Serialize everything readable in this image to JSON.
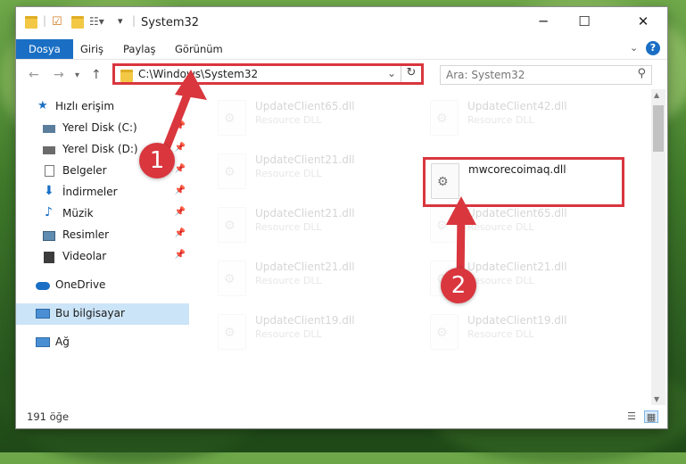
{
  "window": {
    "title": "System32"
  },
  "ribbon": {
    "tabs": [
      {
        "label": "Dosya",
        "active": true
      },
      {
        "label": "Giriş"
      },
      {
        "label": "Paylaş"
      },
      {
        "label": "Görünüm"
      }
    ]
  },
  "address": {
    "path": "C:\\Windows\\System32"
  },
  "search": {
    "placeholder": "Ara: System32"
  },
  "nav": {
    "items": [
      {
        "label": "Hızlı erişim",
        "icon": "star-icon"
      },
      {
        "label": "Yerel Disk (C:)",
        "icon": "drive-icon",
        "pinned": true
      },
      {
        "label": "Yerel Disk (D:)",
        "icon": "drive-icon",
        "pinned": true
      },
      {
        "label": "Belgeler",
        "icon": "documents-icon",
        "pinned": true
      },
      {
        "label": "İndirmeler",
        "icon": "download-icon",
        "pinned": true
      },
      {
        "label": "Müzik",
        "icon": "music-icon",
        "pinned": true
      },
      {
        "label": "Resimler",
        "icon": "pictures-icon",
        "pinned": true
      },
      {
        "label": "Videolar",
        "icon": "videos-icon",
        "pinned": true
      },
      {
        "label": "OneDrive",
        "icon": "cloud-icon"
      },
      {
        "label": "Bu bilgisayar",
        "icon": "computer-icon",
        "selected": true
      },
      {
        "label": "Ağ",
        "icon": "network-icon"
      }
    ]
  },
  "files": [
    {
      "name": "UpdateClient65.dll",
      "type": "Resource DLL"
    },
    {
      "name": "UpdateClient42.dll",
      "type": "Resource DLL"
    },
    {
      "name": "UpdateClient21.dll",
      "type": "Resource DLL"
    },
    {
      "name": "mwcorecoimaq.dll",
      "type": "",
      "highlighted": true
    },
    {
      "name": "UpdateClient21.dll",
      "type": "Resource DLL"
    },
    {
      "name": "UpdateClient65.dll",
      "type": "Resource DLL"
    },
    {
      "name": "UpdateClient21.dll",
      "type": "Resource DLL"
    },
    {
      "name": "UpdateClient21.dll",
      "type": "Resource DLL"
    },
    {
      "name": "UpdateClient19.dll",
      "type": "Resource DLL"
    },
    {
      "name": "UpdateClient19.dll",
      "type": "Resource DLL"
    }
  ],
  "status": {
    "item_count": "191 öğe"
  },
  "callouts": {
    "step1": "1",
    "step2": "2"
  },
  "colors": {
    "accent": "#1a6fc4",
    "highlight": "#d9363e"
  }
}
